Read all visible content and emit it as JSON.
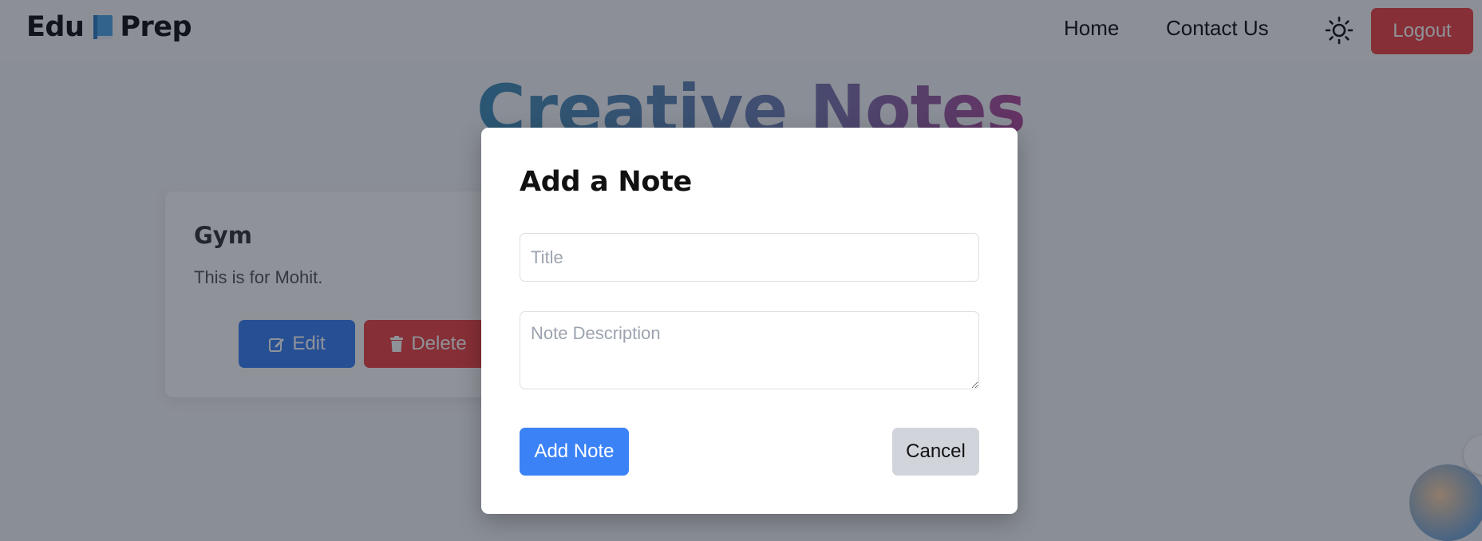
{
  "navbar": {
    "brand_left": "Edu",
    "brand_right": "Prep",
    "links": {
      "home": "Home",
      "contact": "Contact Us"
    },
    "logout_label": "Logout"
  },
  "hero": {
    "title": "Creative Notes"
  },
  "note_card": {
    "title": "Gym",
    "description": "This is for Mohit.",
    "edit_label": "Edit",
    "delete_label": "Delete"
  },
  "modal": {
    "title": "Add a Note",
    "title_field": {
      "placeholder": "Title",
      "value": ""
    },
    "description_field": {
      "placeholder": "Note Description",
      "value": ""
    },
    "add_label": "Add Note",
    "cancel_label": "Cancel"
  },
  "colors": {
    "primary": "#3b82f6",
    "danger": "#ef4444",
    "neutral_button": "#d1d5db"
  },
  "icons": {
    "brand": "book-icon",
    "theme_toggle": "sun-icon",
    "edit": "edit-icon",
    "delete": "trash-icon"
  }
}
